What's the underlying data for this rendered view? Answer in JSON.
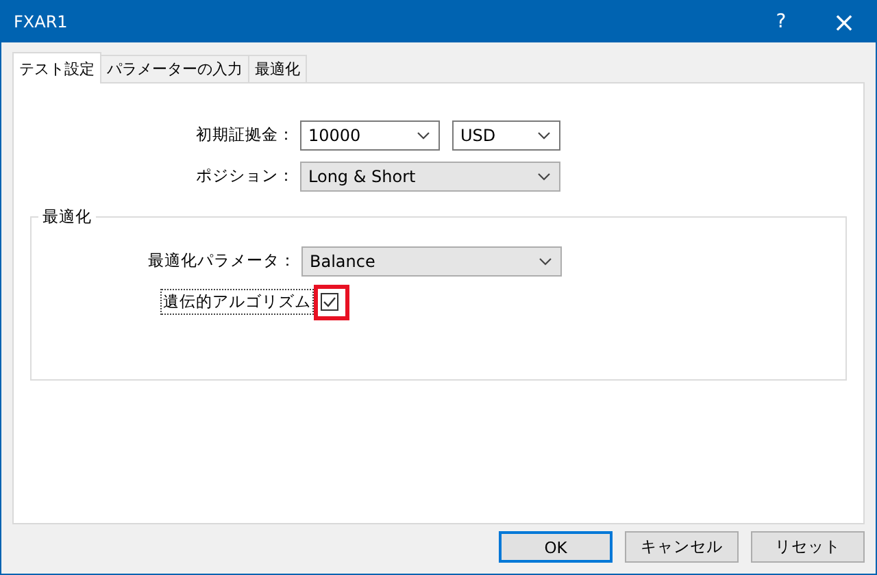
{
  "window": {
    "title": "FXAR1",
    "help": "?",
    "close": "×"
  },
  "tabs": [
    {
      "label": "テスト設定",
      "selected": true
    },
    {
      "label": "パラメーターの入力",
      "selected": false
    },
    {
      "label": "最適化",
      "selected": false
    }
  ],
  "fields": [
    {
      "label": "初期証拠金：",
      "value": "10000",
      "extra": "USD",
      "readonly": false
    },
    {
      "label": "ポジション：",
      "value": "Long & Short",
      "readonly": true
    }
  ],
  "group": {
    "title": "最適化",
    "field": {
      "label": "最適化パラメータ：",
      "value": "Balance",
      "readonly": true
    },
    "checkbox": {
      "label": "遺伝的アルゴリズム",
      "checked": true,
      "highlighted": true
    }
  },
  "buttons": [
    {
      "label": "OK",
      "default": true
    },
    {
      "label": "キャンセル",
      "default": false
    },
    {
      "label": "リセット",
      "default": false
    }
  ]
}
